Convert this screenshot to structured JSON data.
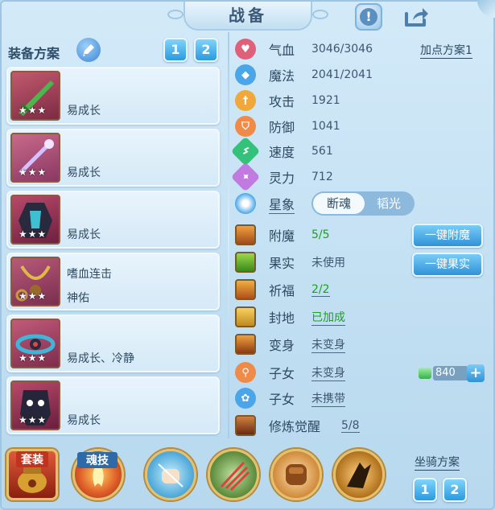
{
  "header": {
    "title": "战备",
    "help_icon": "exclamation-icon",
    "share_icon": "share-arrow-icon"
  },
  "equip_plan": {
    "label": "装备方案",
    "edit_icon": "pencil-icon",
    "tabs": [
      "1",
      "2"
    ]
  },
  "equipment": [
    {
      "name": "",
      "traits": "易成长",
      "stars": "★★★"
    },
    {
      "name": "",
      "traits": "易成长",
      "stars": "★★★"
    },
    {
      "name": "",
      "traits": "易成长",
      "stars": "★★★"
    },
    {
      "name": "嗜血连击",
      "traits": "神佑",
      "stars": "★★★"
    },
    {
      "name": "",
      "traits": "易成长、冷静",
      "stars": "★★★"
    },
    {
      "name": "",
      "traits": "易成长",
      "stars": "★★★"
    }
  ],
  "stats": [
    {
      "label": "气血",
      "value": "3046/3046",
      "icon": "heart-icon",
      "color": "#e0607a"
    },
    {
      "label": "魔法",
      "value": "2041/2041",
      "icon": "mana-drop-icon",
      "color": "#4aa6e8"
    },
    {
      "label": "攻击",
      "value": "1921",
      "icon": "sword-icon",
      "color": "#f0a83a"
    },
    {
      "label": "防御",
      "value": "1041",
      "icon": "shield-icon",
      "color": "#f08a48"
    },
    {
      "label": "速度",
      "value": "561",
      "icon": "lightning-icon",
      "color": "#34c27a"
    },
    {
      "label": "灵力",
      "value": "712",
      "icon": "spirit-icon",
      "color": "#c07ae0"
    }
  ],
  "point_plan": "加点方案1",
  "constellation": {
    "label": "星象",
    "options": [
      "断魂",
      "韬光"
    ],
    "selected": "断魂"
  },
  "features": [
    {
      "label": "附魔",
      "value": "5/5",
      "icon": "enchant-icon"
    },
    {
      "label": "果实",
      "value": "未使用",
      "icon": "fruit-icon"
    },
    {
      "label": "祈福",
      "value": "2/2",
      "icon": "blessing-icon"
    },
    {
      "label": "封地",
      "value": "已加成",
      "icon": "territory-icon"
    },
    {
      "label": "变身",
      "value": "未变身",
      "icon": "transform-icon"
    },
    {
      "label": "子女",
      "value": "未变身",
      "icon": "child-icon"
    },
    {
      "label": "子女",
      "value": "未携带",
      "icon": "paw-icon"
    },
    {
      "label": "修炼觉醒",
      "value": "5/8",
      "icon": "cultivation-icon"
    }
  ],
  "buttons": {
    "auto_enchant": "一键附魔",
    "auto_fruit": "一键果实"
  },
  "currency": {
    "value": "840",
    "icon": "green-gem-icon",
    "plus": "+"
  },
  "bottom": {
    "suit_label": "套装",
    "soul_skill_label": "魂技",
    "skills": [
      "fire-skill-icon",
      "fist-skill-icon",
      "claw-skill-icon",
      "punch-skill-icon",
      "dash-skill-icon"
    ],
    "mount_plan": "坐骑方案",
    "mount_tabs": [
      "1",
      "2"
    ]
  }
}
